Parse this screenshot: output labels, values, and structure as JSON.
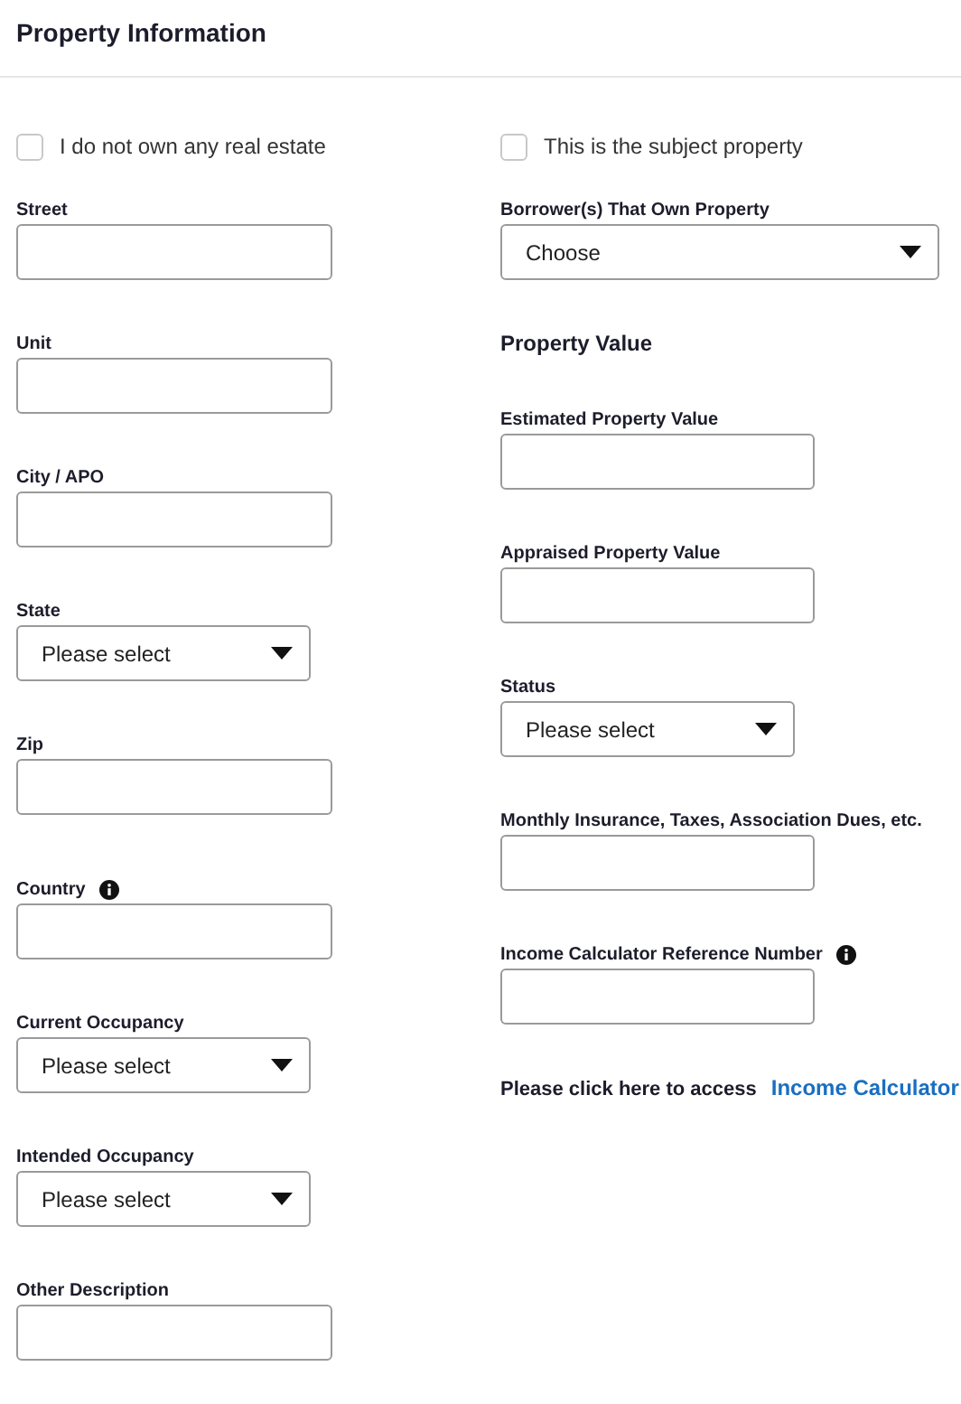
{
  "title": "Property Information",
  "checkboxes": [
    {
      "label": "I do not own any real estate",
      "checked": false
    },
    {
      "label": "This is the subject property",
      "checked": false
    }
  ],
  "left_fields": [
    {
      "kind": "text",
      "label": "Street"
    },
    {
      "kind": "text",
      "label": "Unit"
    },
    {
      "kind": "text",
      "label": "City / APO"
    },
    {
      "kind": "select",
      "label": "State",
      "value": "Please select"
    },
    {
      "kind": "text",
      "label": "Zip"
    },
    {
      "kind": "text",
      "label": "Country",
      "info": true
    },
    {
      "kind": "select",
      "label": "Current Occupancy",
      "value": "Please select"
    },
    {
      "kind": "select",
      "label": "Intended Occupancy",
      "value": "Please select"
    },
    {
      "kind": "text",
      "label": "Other Description"
    }
  ],
  "right_fields": [
    {
      "kind": "select",
      "label": "Borrower(s) That Own Property",
      "value": "Choose"
    },
    {
      "kind": "heading",
      "label": "Property Value"
    },
    {
      "kind": "text",
      "label": "Estimated Property Value"
    },
    {
      "kind": "text",
      "label": "Appraised Property Value"
    },
    {
      "kind": "select",
      "label": "Status",
      "value": "Please select"
    },
    {
      "kind": "text",
      "label": "Monthly Insurance, Taxes, Association Dues, etc."
    },
    {
      "kind": "text",
      "label": "Income Calculator Reference Number",
      "info": true
    },
    {
      "kind": "link",
      "label": "Please click here to access",
      "link": "Income Calculator"
    }
  ]
}
